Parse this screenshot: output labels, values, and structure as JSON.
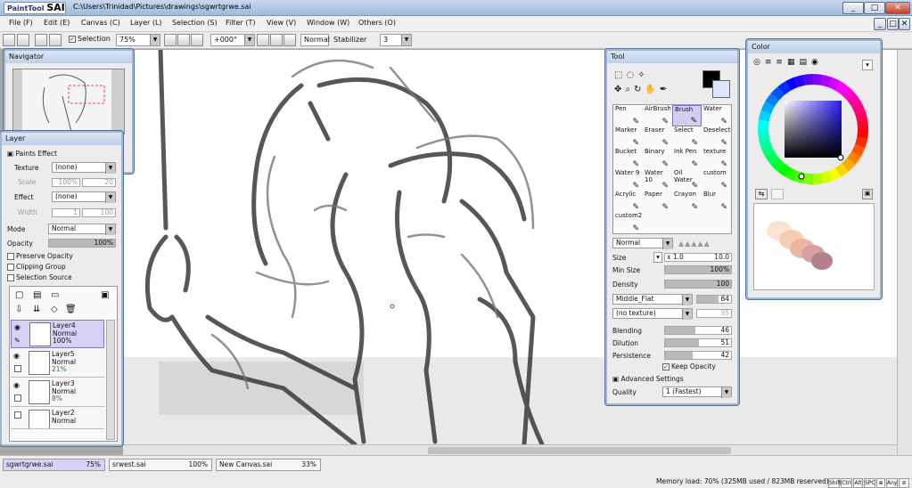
{
  "window": {
    "logo_small": "PaintTool",
    "logo_big": "SAI",
    "title": "C:\\Users\\Trinidad\\Pictures\\drawings\\sgwrtgrwe.sai",
    "controls": [
      "_",
      "□",
      "✕"
    ]
  },
  "menu": [
    {
      "label": "File (F)"
    },
    {
      "label": "Edit (E)"
    },
    {
      "label": "Canvas (C)"
    },
    {
      "label": "Layer (L)"
    },
    {
      "label": "Selection (S)"
    },
    {
      "label": "Filter (T)"
    },
    {
      "label": "View (V)"
    },
    {
      "label": "Window (W)"
    },
    {
      "label": "Others (O)"
    }
  ],
  "menu_right_controls": [
    "_",
    "□",
    "✕"
  ],
  "toolbar": {
    "selection_label": "Selection",
    "selection_checked": true,
    "zoom": "75%",
    "rotation": "+000°",
    "blend_mode": "Normal",
    "stabilizer_label": "Stabilizer",
    "stabilizer_value": "3"
  },
  "navigator": {
    "title": "Navigator"
  },
  "layer_panel": {
    "title": "Layer",
    "paints_effect": "Paints Effect",
    "texture_label": "Texture",
    "texture_value": "(none)",
    "scale_label": "Scale",
    "scale_value": "100%",
    "scale_num": "20",
    "effect_label": "Effect",
    "effect_value": "(none)",
    "width_label": "Width",
    "width_value": "1",
    "width_num": "100",
    "mode_label": "Mode",
    "mode_value": "Normal",
    "opacity_label": "Opacity",
    "opacity_value": "100%",
    "opacity_fraction": 1.0,
    "preserve_opacity": "Preserve Opacity",
    "clipping_group": "Clipping Group",
    "selection_source": "Selection Source",
    "layers": [
      {
        "name": "Layer4",
        "mode": "Normal",
        "opacity": "100%",
        "active": true
      },
      {
        "name": "Layer5",
        "mode": "Normal",
        "opacity": "21%",
        "active": false
      },
      {
        "name": "Layer3",
        "mode": "Normal",
        "opacity": "8%",
        "active": false
      },
      {
        "name": "Layer2",
        "mode": "Normal",
        "opacity": "",
        "active": false
      }
    ]
  },
  "tool_panel": {
    "title": "Tool",
    "tools": [
      {
        "label": "Pen"
      },
      {
        "label": "AirBrush"
      },
      {
        "label": "Brush"
      },
      {
        "label": "Water"
      },
      {
        "label": "Marker"
      },
      {
        "label": "Eraser"
      },
      {
        "label": "Select"
      },
      {
        "label": "Deselect"
      },
      {
        "label": "Bucket"
      },
      {
        "label": "Binary"
      },
      {
        "label": "Ink Pen"
      },
      {
        "label": "texture"
      },
      {
        "label": "Water 9"
      },
      {
        "label": "Water 10"
      },
      {
        "label": "Oil Water"
      },
      {
        "label": "custom"
      },
      {
        "label": "Acrylic"
      },
      {
        "label": "Paper"
      },
      {
        "label": "Crayon"
      },
      {
        "label": "Blur"
      },
      {
        "label": "custom2"
      }
    ],
    "active_tool": "Brush",
    "mode_value": "Normal",
    "size_label": "Size",
    "size_multiplier": "x 1.0",
    "size_value": "10.0",
    "min_size_label": "Min Size",
    "min_size_value": "100%",
    "density_label": "Density",
    "density_value": "100",
    "shape_value": "Middle_Flat",
    "shape_num": "64",
    "texture_value": "(no texture)",
    "texture_num": "95",
    "blending_label": "Blending",
    "blending_value": "46",
    "dilution_label": "Dilution",
    "dilution_value": "51",
    "persistence_label": "Persistence",
    "persistence_value": "42",
    "keep_opacity": "Keep Opacity",
    "advanced_settings": "Advanced Settings",
    "quality_label": "Quality",
    "quality_value": "1 (Fastest)"
  },
  "color_panel": {
    "title": "Color",
    "primary_color": "#000000",
    "hue_color": "#2a1cff"
  },
  "file_tabs": [
    {
      "name": "sgwrtgrwe.sai",
      "zoom": "75%",
      "active": true
    },
    {
      "name": "srwest.sai",
      "zoom": "100%",
      "active": false
    },
    {
      "name": "New Canvas.sai",
      "zoom": "33%",
      "active": false
    }
  ],
  "status": {
    "memory": "Memory load: 70% (325MB used / 823MB reserved)",
    "keys": [
      "Shift",
      "Ctrl",
      "Alt",
      "SPC",
      "⊕",
      "Any",
      "⊘"
    ]
  }
}
